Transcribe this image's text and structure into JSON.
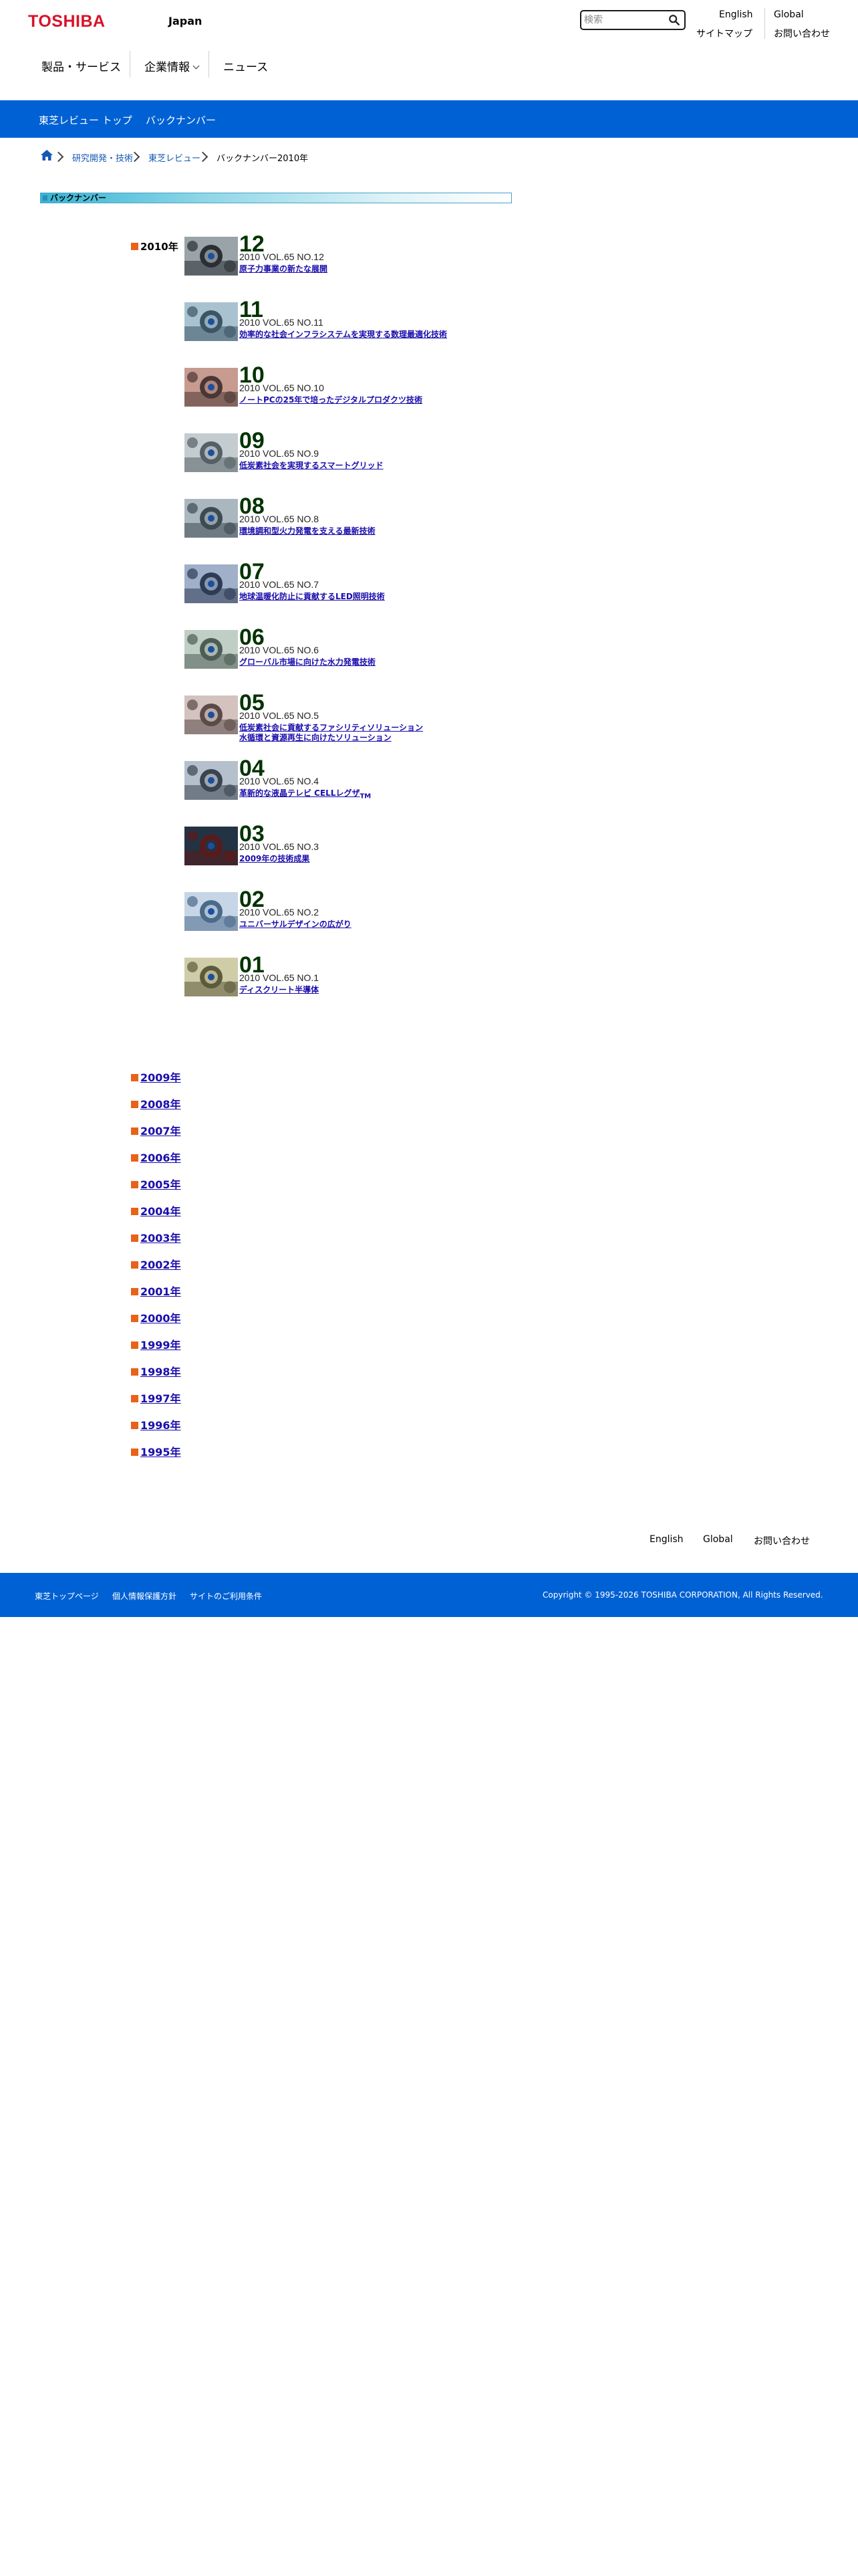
{
  "header": {
    "logo": "TOSHIBA",
    "region": "Japan",
    "search_placeholder": "検索",
    "util_links": [
      "English",
      "Global",
      "サイトマップ",
      "お問い合わせ"
    ]
  },
  "nav": {
    "items": [
      "製品・サービス",
      "企業情報",
      "ニュース"
    ]
  },
  "subnav": {
    "items": [
      "東芝レビュー トップ",
      "バックナンバー"
    ]
  },
  "breadcrumb": {
    "items": [
      "研究開発・技術",
      "東芝レビュー",
      "バックナンバー2010年"
    ]
  },
  "section": {
    "title": "バックナンバー",
    "current_year": "2010年"
  },
  "issues": [
    {
      "num": "12",
      "vol": "2010 VOL.65 NO.12",
      "title": "原子力事業の新たな展開"
    },
    {
      "num": "11",
      "vol": "2010 VOL.65 NO.11",
      "title": "効率的な社会インフラシステムを実現する数理最適化技術"
    },
    {
      "num": "10",
      "vol": "2010 VOL.65 NO.10",
      "title": "ノートPCの25年で培ったデジタルプロダクツ技術"
    },
    {
      "num": "09",
      "vol": "2010 VOL.65 NO.9",
      "title": "低炭素社会を実現するスマートグリッド"
    },
    {
      "num": "08",
      "vol": "2010 VOL.65 NO.8",
      "title": "環境調和型火力発電を支える最新技術"
    },
    {
      "num": "07",
      "vol": "2010 VOL.65 NO.7",
      "title": "地球温暖化防止に貢献するLED照明技術"
    },
    {
      "num": "06",
      "vol": "2010 VOL.65 NO.6",
      "title": "グローバル市場に向けた水力発電技術"
    },
    {
      "num": "05",
      "vol": "2010 VOL.65 NO.5",
      "title": "低炭素社会に貢献するファシリティソリューション",
      "title2": "水循環と資源再生に向けたソリューション"
    },
    {
      "num": "04",
      "vol": "2010 VOL.65 NO.4",
      "title": "革新的な液晶テレビ CELLレグザ",
      "tm": "TM"
    },
    {
      "num": "03",
      "vol": "2010 VOL.65 NO.3",
      "title": "2009年の技術成果"
    },
    {
      "num": "02",
      "vol": "2010 VOL.65 NO.2",
      "title": "ユニバーサルデザインの広がり"
    },
    {
      "num": "01",
      "vol": "2010 VOL.65 NO.1",
      "title": "ディスクリート半導体"
    }
  ],
  "years": [
    "2009年",
    "2008年",
    "2007年",
    "2006年",
    "2005年",
    "2004年",
    "2003年",
    "2002年",
    "2001年",
    "2000年",
    "1999年",
    "1998年",
    "1997年",
    "1996年",
    "1995年"
  ],
  "footer": {
    "links": [
      "English",
      "Global",
      "お問い合わせ"
    ],
    "bottom_links": [
      "東芝トップページ",
      "個人情報保護方針",
      "サイトのご利用条件"
    ],
    "copyright": "Copyright © 1995-2026 TOSHIBA CORPORATION, All Rights Reserved."
  },
  "colors": {
    "brand_red": "#d7132a",
    "bar_blue": "#0061d4",
    "link": "#1a0dab",
    "bullet_orange": "#e8621a",
    "issue_number": "#003300"
  }
}
